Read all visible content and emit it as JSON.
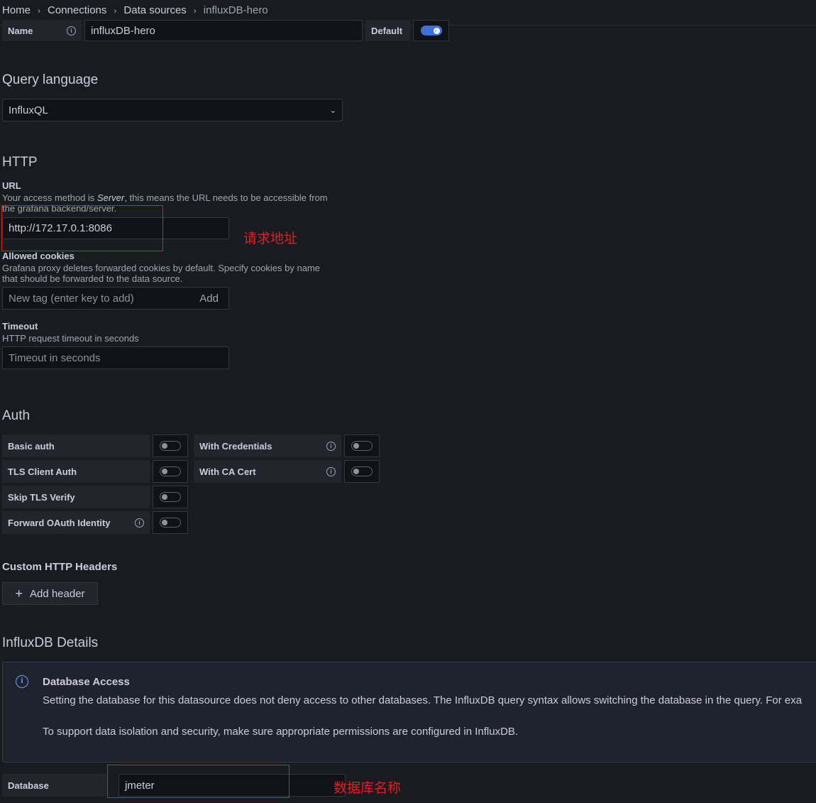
{
  "breadcrumb": {
    "items": [
      "Home",
      "Connections",
      "Data sources",
      "influxDB-hero"
    ]
  },
  "name_row": {
    "label": "Name",
    "value": "influxDB-hero",
    "default_label": "Default",
    "default_on": true
  },
  "query_language": {
    "title": "Query language",
    "selected": "InfluxQL"
  },
  "http": {
    "title": "HTTP",
    "url": {
      "label": "URL",
      "desc_pre": "Your access method is ",
      "desc_em": "Server",
      "desc_post": ", this means the URL needs to be accessible from the grafana backend/server.",
      "value": "http://172.17.0.1:8086",
      "annotation": "请求地址"
    },
    "cookies": {
      "label": "Allowed cookies",
      "desc": "Grafana proxy deletes forwarded cookies by default. Specify cookies by name that should be forwarded to the data source.",
      "placeholder": "New tag (enter key to add)",
      "add_label": "Add"
    },
    "timeout": {
      "label": "Timeout",
      "desc": "HTTP request timeout in seconds",
      "placeholder": "Timeout in seconds"
    }
  },
  "auth": {
    "title": "Auth",
    "basic_auth": "Basic auth",
    "with_credentials": "With Credentials",
    "tls_client_auth": "TLS Client Auth",
    "with_ca_cert": "With CA Cert",
    "skip_tls_verify": "Skip TLS Verify",
    "forward_oauth": "Forward OAuth Identity"
  },
  "custom_headers": {
    "title": "Custom HTTP Headers",
    "add_label": "Add header"
  },
  "influx_details": {
    "title": "InfluxDB Details",
    "alert_title": "Database Access",
    "alert_line1": "Setting the database for this datasource does not deny access to other databases. The InfluxDB query syntax allows switching the database in the query. For exa",
    "alert_line2": "To support data isolation and security, make sure appropriate permissions are configured in InfluxDB.",
    "database_label": "Database",
    "database_value": "jmeter",
    "annotation": "数据库名称"
  },
  "colors": {
    "background": "#181b1f",
    "accent": "#3d71d9",
    "annotation": "#e02020"
  }
}
